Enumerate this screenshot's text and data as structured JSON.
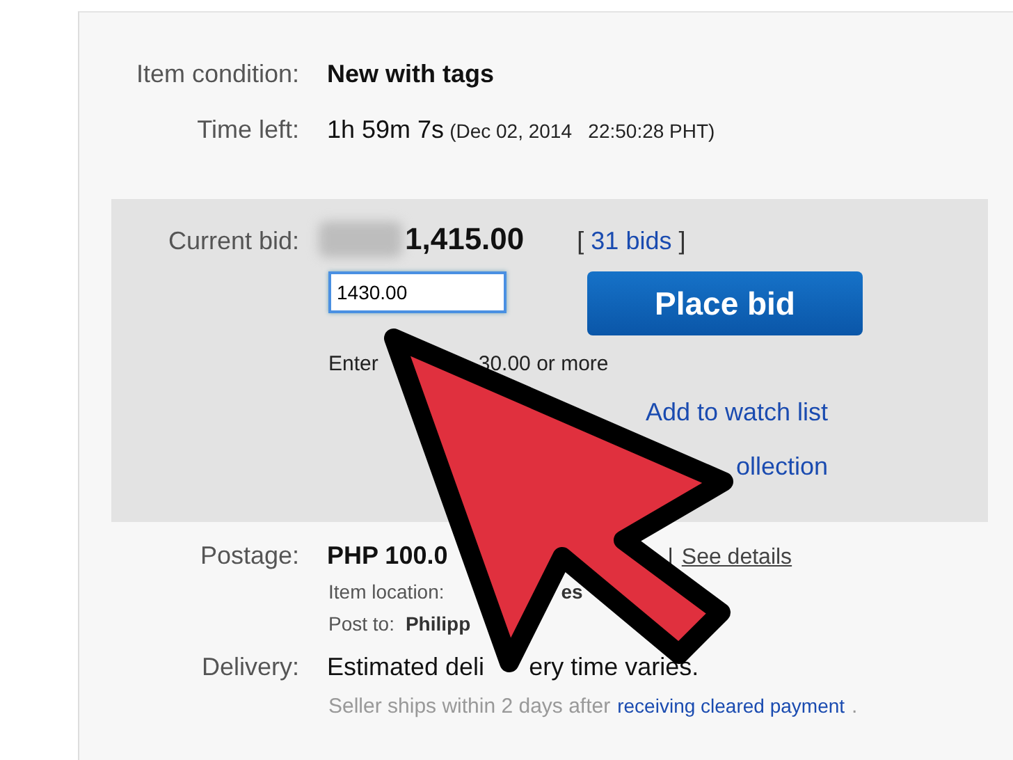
{
  "details": [
    {
      "label": "Item condition:",
      "value": "New with tags",
      "kind": "bold"
    },
    {
      "label": "Time left:",
      "value": "1h 59m 7s",
      "note": "(Dec 02, 2014   22:50:28 PHT)",
      "kind": "plain"
    }
  ],
  "bid": {
    "label": "Current bid:",
    "amount": "1,415.00",
    "bracket_open": "[",
    "bids_link": "31 bids",
    "bracket_close": "]",
    "input_value": "1430.00",
    "button": "Place bid",
    "hint_parts": [
      "Enter",
      "30.00 or more"
    ],
    "links": [
      "Add to watch list",
      "ollection"
    ]
  },
  "postage": {
    "label": "Postage:",
    "value": "PHP 100.0",
    "separator": "|",
    "link": "See details",
    "lines": [
      {
        "label": "Item location:",
        "value": "es"
      },
      {
        "label": "Post to:",
        "value": "Philipp"
      }
    ]
  },
  "delivery": {
    "label": "Delivery:",
    "value_parts": [
      "Estimated deli",
      "ery time varies."
    ],
    "note": "Seller ships within 2 days after",
    "link": "receiving cleared payment",
    "tail": "."
  }
}
